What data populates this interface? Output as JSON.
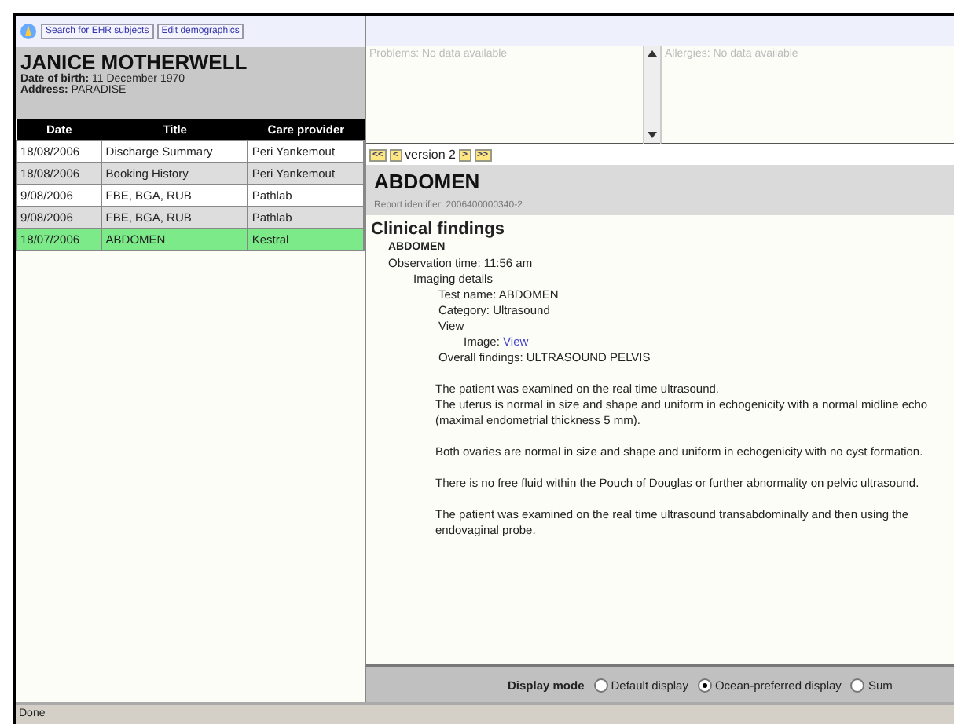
{
  "toolbar": {
    "buttons": [
      "Search for EHR subjects",
      "Edit demographics"
    ]
  },
  "patient": {
    "name": "JANICE MOTHERWELL",
    "dob_label": "Date of birth:",
    "dob": "11 December 1970",
    "address_label": "Address:",
    "address": "PARADISE"
  },
  "table": {
    "columns": [
      "Date",
      "Title",
      "Care provider"
    ],
    "rows": [
      {
        "cells": [
          "18/08/2006",
          "Discharge Summary",
          "Peri Yankemout"
        ],
        "selected": false
      },
      {
        "cells": [
          "18/08/2006",
          "Booking History",
          "Peri Yankemout"
        ],
        "selected": false
      },
      {
        "cells": [
          "9/08/2006",
          "FBE, BGA, RUB",
          "Pathlab"
        ],
        "selected": false
      },
      {
        "cells": [
          "9/08/2006",
          "FBE, BGA, RUB",
          "Pathlab"
        ],
        "selected": false
      },
      {
        "cells": [
          "18/07/2006",
          "ABDOMEN",
          "Kestral"
        ],
        "selected": true
      }
    ]
  },
  "problems": {
    "placeholder": "Problems: No data available"
  },
  "allergies": {
    "placeholder": "Allergies: No data available"
  },
  "version_nav": {
    "first": "<<",
    "prev": "<",
    "label": "version 2",
    "next": ">",
    "last": ">>"
  },
  "report": {
    "title": "ABDOMEN",
    "identifier": "Report identifier: 2006400000340-2",
    "section": "Clinical findings",
    "heading": "ABDOMEN",
    "items": [
      {
        "text": "Observation time: 11:56 am",
        "children": [
          {
            "text": "Imaging details",
            "children": [
              {
                "text": "Test name: ABDOMEN"
              },
              {
                "text": "Category: Ultrasound"
              },
              {
                "text": "View",
                "children": [
                  {
                    "text": "Image:",
                    "link": "View"
                  }
                ]
              },
              {
                "text": "Overall findings: ULTRASOUND PELVIS"
              }
            ]
          }
        ]
      }
    ],
    "paragraphs": [
      "The patient was examined on the real time ultrasound.\nThe uterus is normal in size and shape and uniform in echogenicity with a normal midline echo (maximal endometrial thickness 5 mm).",
      "Both ovaries are normal in size and shape and uniform in echogenicity with no cyst formation.",
      "There is no free fluid within the Pouch of Douglas or further abnormality on pelvic ultrasound.",
      "The patient was examined on the real time ultrasound transabdominally and then using the endovaginal probe."
    ]
  },
  "display_mode": {
    "label": "Display mode",
    "options": [
      {
        "label": "Default display",
        "selected": false
      },
      {
        "label": "Ocean-preferred display",
        "selected": true
      },
      {
        "label": "Sum",
        "selected": false
      }
    ]
  },
  "status_bar": "Done"
}
